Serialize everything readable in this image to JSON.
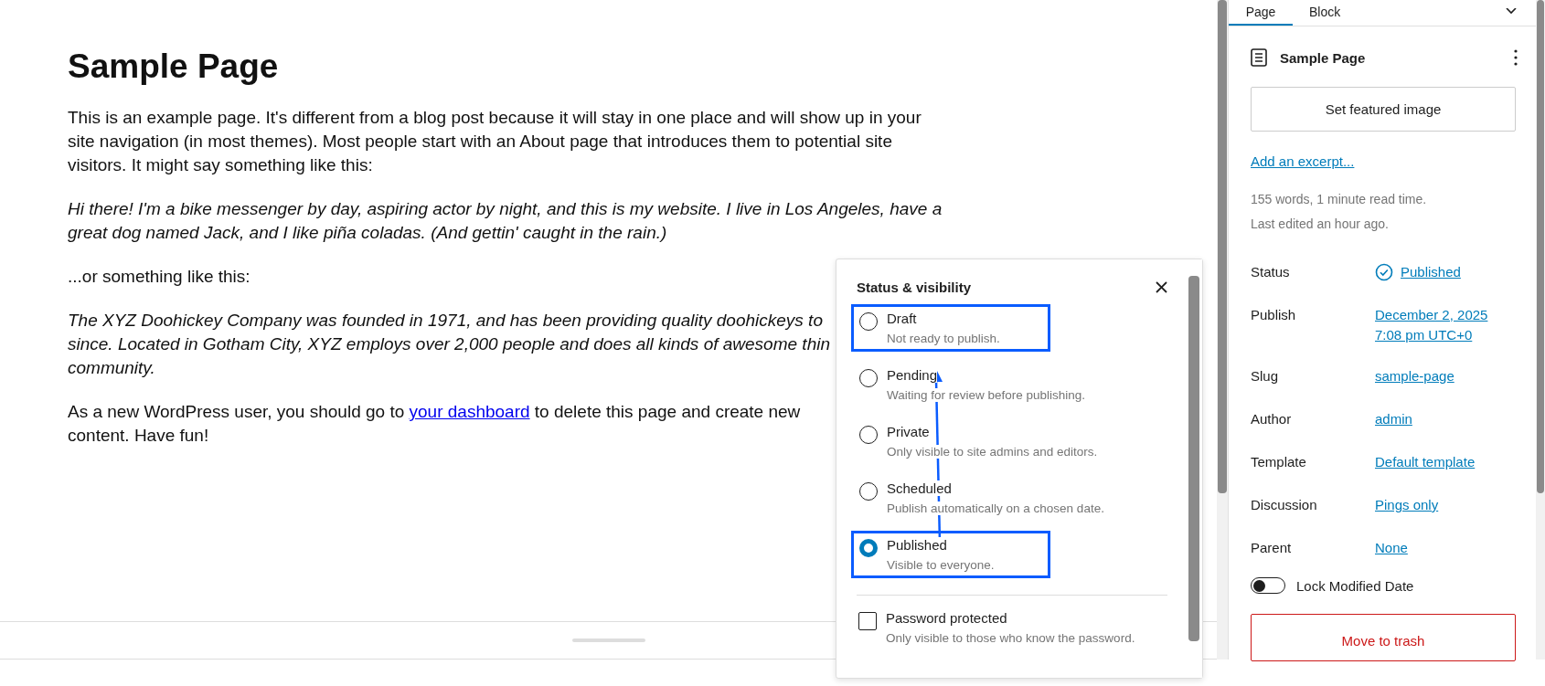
{
  "content": {
    "title": "Sample Page",
    "paragraphs": [
      {
        "kind": "plain",
        "lines": [
          [
            {
              "text": "This is an example page. It's different from a blog post because it will stay in one place and will show up in your"
            }
          ],
          [
            {
              "text": "site navigation (in most themes). Most people start with an About page that introduces them to potential site"
            }
          ],
          [
            {
              "text": "visitors. It might say something like this:"
            }
          ]
        ]
      },
      {
        "kind": "italic",
        "lines": [
          [
            {
              "text": "Hi there! I'm a bike messenger by day, aspiring actor by night, and this is my website. I live in Los Angeles, have a"
            }
          ],
          [
            {
              "text": "great dog named Jack, and I like piña coladas. (And gettin' caught in the rain.)"
            }
          ]
        ]
      },
      {
        "kind": "plain",
        "lines": [
          [
            {
              "text": "...or something like this:"
            }
          ]
        ]
      },
      {
        "kind": "italic",
        "lines": [
          [
            {
              "text": "The XYZ Doohickey Company was founded in 1971, and has been providing quality doohickeys to"
            }
          ],
          [
            {
              "text": "since. Located in Gotham City, XYZ employs over 2,000 people and does all kinds of awesome thin"
            }
          ],
          [
            {
              "text": "community."
            }
          ]
        ]
      },
      {
        "kind": "plain",
        "lines": [
          [
            {
              "text": "As a new WordPress user, you should go to "
            },
            {
              "text": "your dashboard",
              "link": true
            },
            {
              "text": " to delete this page and create new"
            }
          ],
          [
            {
              "text": "content. Have fun!"
            }
          ]
        ]
      }
    ]
  },
  "popover": {
    "title": "Status & visibility",
    "options": [
      {
        "label": "Draft",
        "description": "Not ready to publish.",
        "selected": false,
        "highlighted": true
      },
      {
        "label": "Pending",
        "description": "Waiting for review before publishing.",
        "selected": false,
        "highlighted": false
      },
      {
        "label": "Private",
        "description": "Only visible to site admins and editors.",
        "selected": false,
        "highlighted": false
      },
      {
        "label": "Scheduled",
        "description": "Publish automatically on a chosen date.",
        "selected": false,
        "highlighted": false
      },
      {
        "label": "Published",
        "description": "Visible to everyone.",
        "selected": true,
        "highlighted": true
      }
    ],
    "password": {
      "label": "Password protected",
      "description": "Only visible to those who know the password.",
      "checked": false
    }
  },
  "sidebar": {
    "tabs": [
      {
        "label": "Page",
        "selected": true
      },
      {
        "label": "Block",
        "selected": false
      }
    ],
    "page_title": "Sample Page",
    "featured_image_button": "Set featured image",
    "excerpt_link": "Add an excerpt...",
    "stats": [
      "155 words, 1 minute read time.",
      "Last edited an hour ago."
    ],
    "fields": [
      {
        "label": "Status",
        "value": "Published",
        "kind": "status"
      },
      {
        "label": "Publish",
        "value": "December 2, 2025 7:08 pm UTC+0",
        "kind": "link"
      },
      {
        "label": "Slug",
        "value": "sample-page",
        "kind": "link"
      },
      {
        "label": "Author",
        "value": "admin",
        "kind": "link"
      },
      {
        "label": "Template",
        "value": "Default template",
        "kind": "link"
      },
      {
        "label": "Discussion",
        "value": "Pings only",
        "kind": "link"
      },
      {
        "label": "Parent",
        "value": "None",
        "kind": "link"
      }
    ],
    "toggle": {
      "label": "Lock Modified Date",
      "on": false
    },
    "trash_button": "Move to trash"
  }
}
